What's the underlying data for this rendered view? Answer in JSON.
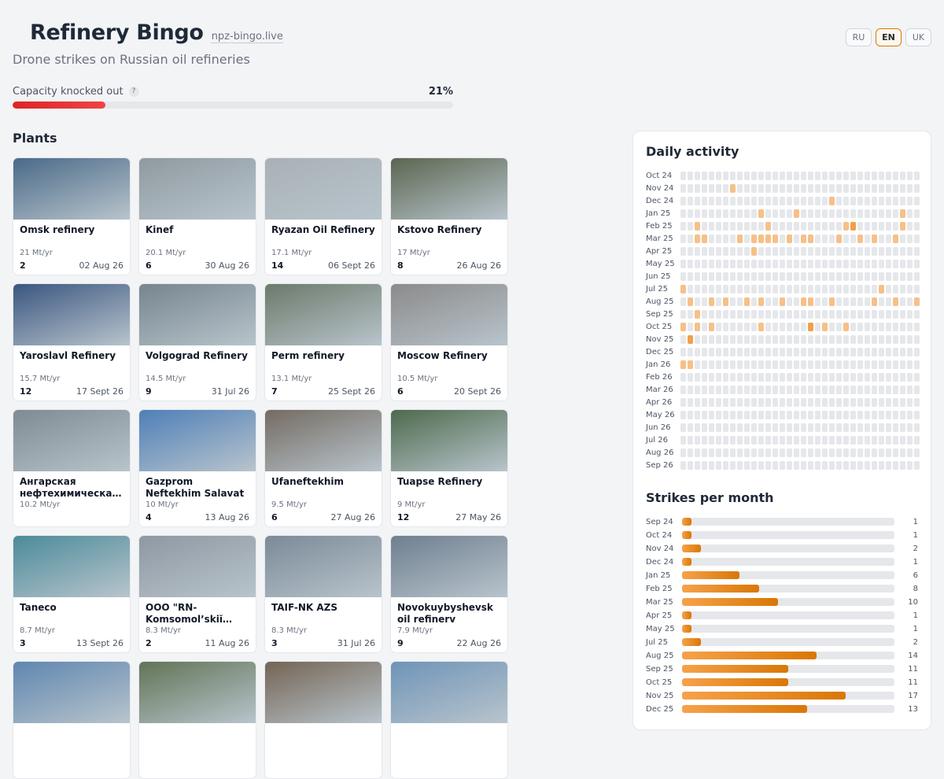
{
  "header": {
    "title": "Refinery Bingo",
    "domain": "npz-bingo.live",
    "subtitle": "Drone strikes on Russian oil refineries"
  },
  "languages": [
    {
      "label": "RU",
      "active": false
    },
    {
      "label": "EN",
      "active": true
    },
    {
      "label": "UK",
      "active": false
    }
  ],
  "capacity": {
    "label": "Capacity knocked out",
    "help_icon": "?",
    "value_text": "21%",
    "fraction": 0.21
  },
  "plants": {
    "heading": "Plants",
    "items": [
      {
        "name": "Omsk refinery",
        "capacity": "21 Mt/yr",
        "strikes": "2",
        "date": "02 Aug 26",
        "thumb": "#4a6a88"
      },
      {
        "name": "Kinef",
        "capacity": "20.1 Mt/yr",
        "strikes": "6",
        "date": "30 Aug 26",
        "thumb": "#8f9aa0"
      },
      {
        "name": "Ryazan Oil Refinery",
        "capacity": "17.1 Mt/yr",
        "strikes": "14",
        "date": "06 Sept 26",
        "thumb": "#a9b1b6"
      },
      {
        "name": "Kstovo Refinery",
        "capacity": "17 Mt/yr",
        "strikes": "8",
        "date": "26 Aug 26",
        "thumb": "#5b6650"
      },
      {
        "name": "Yaroslavl Refinery",
        "capacity": "15.7 Mt/yr",
        "strikes": "12",
        "date": "17 Sept 26",
        "thumb": "#3a5680"
      },
      {
        "name": "Volgograd Refinery",
        "capacity": "14.5 Mt/yr",
        "strikes": "9",
        "date": "31 Jul 26",
        "thumb": "#76858e"
      },
      {
        "name": "Perm refinery",
        "capacity": "13.1 Mt/yr",
        "strikes": "7",
        "date": "25 Sept 26",
        "thumb": "#6c7a6a"
      },
      {
        "name": "Moscow Refinery",
        "capacity": "10.5 Mt/yr",
        "strikes": "6",
        "date": "20 Sept 26",
        "thumb": "#8b8b8b"
      },
      {
        "name": "Ангарская нефтехимическая компания",
        "capacity": "10.2 Mt/yr",
        "strikes": "",
        "date": "",
        "thumb": "#7f8b93"
      },
      {
        "name": "Gazprom Neftekhim Salavat",
        "capacity": "10 Mt/yr",
        "strikes": "4",
        "date": "13 Aug 26",
        "thumb": "#4f7fb8"
      },
      {
        "name": "Ufaneftekhim",
        "capacity": "9.5 Mt/yr",
        "strikes": "6",
        "date": "27 Aug 26",
        "thumb": "#746b62"
      },
      {
        "name": "Tuapse Refinery",
        "capacity": "9 Mt/yr",
        "strikes": "12",
        "date": "27 May 26",
        "thumb": "#4d6a4c"
      },
      {
        "name": "Taneco",
        "capacity": "8.7 Mt/yr",
        "strikes": "3",
        "date": "13 Sept 26",
        "thumb": "#4b8b9a"
      },
      {
        "name": "OOO \"RN-Komsomol’skiĭ…",
        "capacity": "8.3 Mt/yr",
        "strikes": "2",
        "date": "11 Aug 26",
        "thumb": "#8e98a2"
      },
      {
        "name": "TAIF-NK AZS",
        "capacity": "8.3 Mt/yr",
        "strikes": "3",
        "date": "31 Jul 26",
        "thumb": "#7b8a98"
      },
      {
        "name": "Novokuybyshevsk oil refinerv",
        "capacity": "7.9 Mt/yr",
        "strikes": "9",
        "date": "22 Aug 26",
        "thumb": "#6f7f90"
      },
      {
        "name": "",
        "capacity": "",
        "strikes": "",
        "date": "",
        "thumb": "#5f86b0"
      },
      {
        "name": "",
        "capacity": "",
        "strikes": "",
        "date": "",
        "thumb": "#617456"
      },
      {
        "name": "",
        "capacity": "",
        "strikes": "",
        "date": "",
        "thumb": "#746454"
      },
      {
        "name": "",
        "capacity": "",
        "strikes": "",
        "date": "",
        "thumb": "#6f94b8"
      }
    ]
  },
  "daily_activity": {
    "title": "Daily activity",
    "colors": {
      "none": "#e5e7eb",
      "one": "#f6c088",
      "two": "#f0a04b",
      "many": "#e0691a"
    },
    "rows": [
      {
        "label": "Oct 24",
        "cells": "0000000000000000000000000000000000000001"
      },
      {
        "label": "Nov 24",
        "cells": "0000000100000000000000000000000000000100"
      },
      {
        "label": "Dec 24",
        "cells": "0000000000000000000001000000000000000000"
      },
      {
        "label": "Jan 25",
        "cells": "0000000000010000100000000000000100100101"
      },
      {
        "label": "Feb 25",
        "cells": "0010000000001000000000012000000100100000"
      },
      {
        "label": "Mar 25",
        "cells": "0011000010111101011000100101001000000000"
      },
      {
        "label": "Apr 25",
        "cells": "0000000000100000000000000000000000000000"
      },
      {
        "label": "May 25",
        "cells": "0000000000000000000000000000000000000000"
      },
      {
        "label": "Jun 25",
        "cells": "0000000000000000000000000000000000000000"
      },
      {
        "label": "Jul 25",
        "cells": "1000000000000000000000000000100000000000"
      },
      {
        "label": "Aug 25",
        "cells": "0100101001010010011001000001001001010210"
      },
      {
        "label": "Sep 25",
        "cells": "0010000000000000000000000000000000000000"
      },
      {
        "label": "Oct 25",
        "cells": "1010100000010000002010010000000000000000"
      },
      {
        "label": "Nov 25",
        "cells": "0200000000000000000000000000000000000000"
      },
      {
        "label": "Dec 25",
        "cells": "0000000000000000000000000000000000000000"
      },
      {
        "label": "Jan 26",
        "cells": "1100000000000000000000000000000000000000"
      },
      {
        "label": "Feb 26",
        "cells": "0000000000000000000000000000000000000000"
      },
      {
        "label": "Mar 26",
        "cells": "0000000000000000000000000000000000000000"
      },
      {
        "label": "Apr 26",
        "cells": "0000000000000000000000000000000000000000"
      },
      {
        "label": "May 26",
        "cells": "0000000000000000000000000000000000000000"
      },
      {
        "label": "Jun 26",
        "cells": "0000000000000000000000000000000000000000"
      },
      {
        "label": "Jul 26",
        "cells": "0000000000000000000000000000000000000000"
      },
      {
        "label": "Aug 26",
        "cells": "0000000000000000000000000000000000000000"
      },
      {
        "label": "Sep 26",
        "cells": "0000000000000000000000000000000000000000"
      }
    ]
  },
  "strikes_per_month": {
    "title": "Strikes per month",
    "max": 17,
    "rows": [
      {
        "month": "Sep 24",
        "count": 1
      },
      {
        "month": "Oct 24",
        "count": 1
      },
      {
        "month": "Nov 24",
        "count": 2
      },
      {
        "month": "Dec 24",
        "count": 1
      },
      {
        "month": "Jan 25",
        "count": 6
      },
      {
        "month": "Feb 25",
        "count": 8
      },
      {
        "month": "Mar 25",
        "count": 10
      },
      {
        "month": "Apr 25",
        "count": 1
      },
      {
        "month": "May 25",
        "count": 1
      },
      {
        "month": "Jul 25",
        "count": 2
      },
      {
        "month": "Aug 25",
        "count": 14
      },
      {
        "month": "Sep 25",
        "count": 11
      },
      {
        "month": "Oct 25",
        "count": 11
      },
      {
        "month": "Nov 25",
        "count": 17
      },
      {
        "month": "Dec 25",
        "count": 13
      }
    ]
  }
}
